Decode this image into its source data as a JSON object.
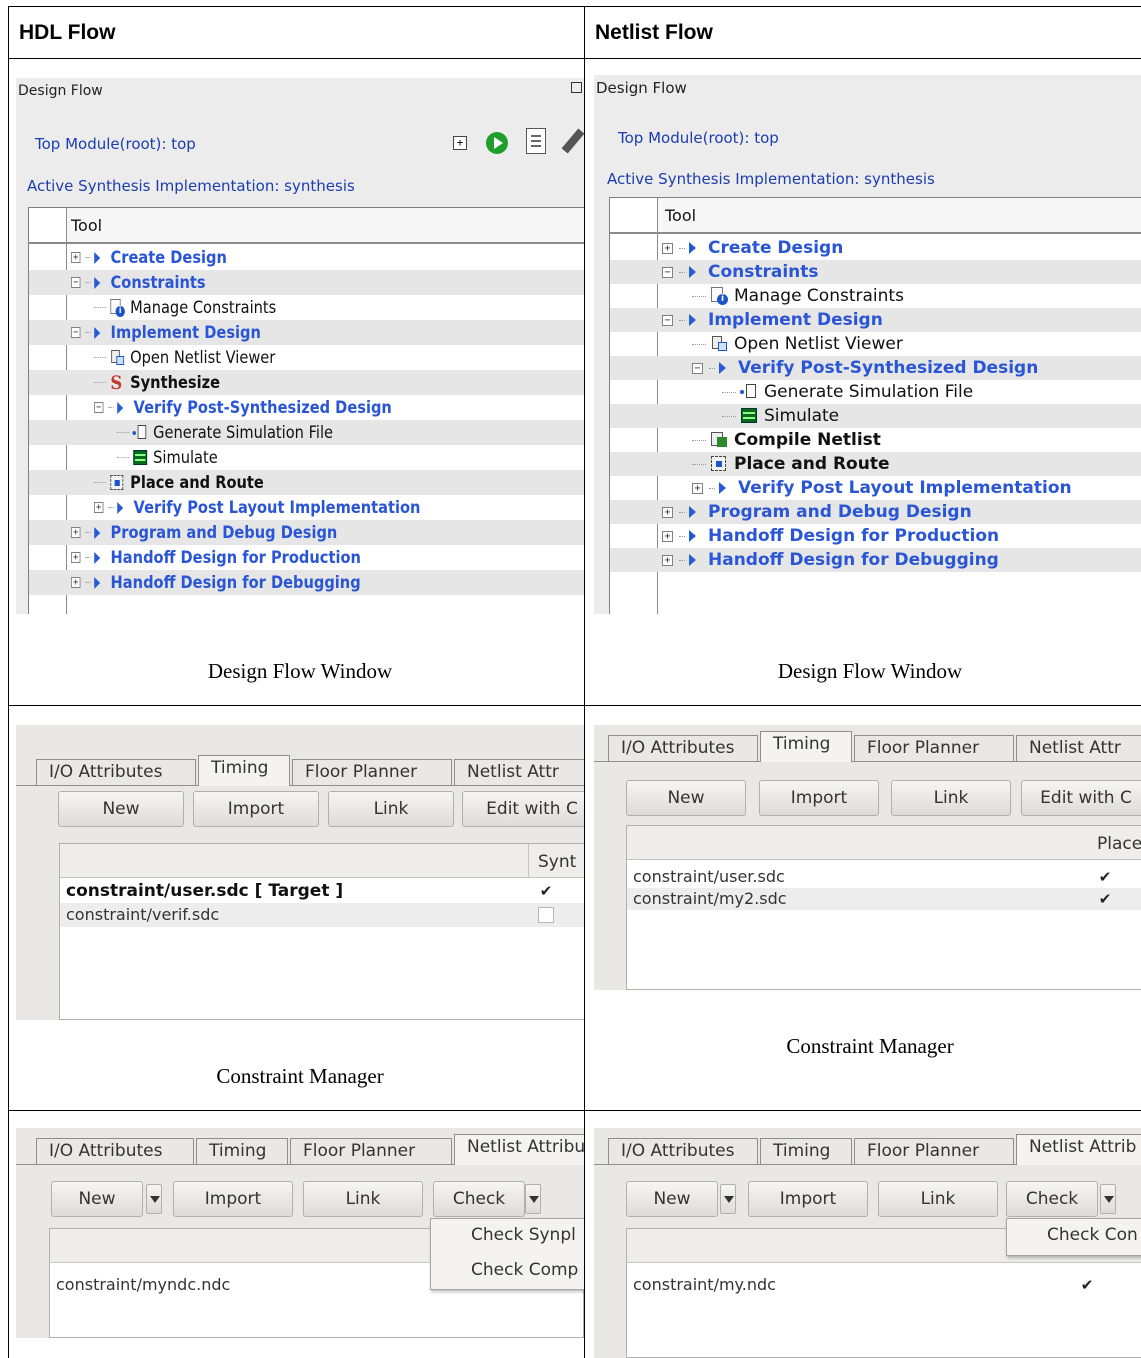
{
  "headers": {
    "hdl": "HDL Flow",
    "netlist": "Netlist Flow"
  },
  "captions": {
    "df_hdl": "Design Flow Window",
    "df_netlist": "Design Flow Window",
    "cm_hdl": "Constraint Manager",
    "cm_netlist": "Constraint Manager"
  },
  "design_flow_hdl": {
    "title": "Design Flow",
    "top_module": "Top Module(root): top",
    "active_impl": "Active Synthesis Implementation: synthesis",
    "column_header": "Tool",
    "toolbar_icons": [
      "expand-all-icon",
      "run-icon",
      "report-icon",
      "wrench-icon"
    ],
    "rows": [
      {
        "label": "Create Design",
        "style": "blue",
        "indent": 0,
        "expander": "+",
        "icon": "triangle"
      },
      {
        "label": "Constraints",
        "style": "blue",
        "indent": 0,
        "expander": "−",
        "icon": "triangle"
      },
      {
        "label": "Manage Constraints",
        "style": "black",
        "indent": 1,
        "icon": "info-doc-icon"
      },
      {
        "label": "Implement Design",
        "style": "blue",
        "indent": 0,
        "expander": "−",
        "icon": "triangle"
      },
      {
        "label": "Open Netlist Viewer",
        "style": "black",
        "indent": 1,
        "icon": "netlist-viewer-icon"
      },
      {
        "label": "Synthesize",
        "style": "bold",
        "indent": 1,
        "icon": "synthesize-icon"
      },
      {
        "label": "Verify Post-Synthesized Design",
        "style": "blue",
        "indent": 1,
        "expander": "−",
        "icon": "triangle"
      },
      {
        "label": "Generate Simulation File",
        "style": "black",
        "indent": 2,
        "icon": "file-icon"
      },
      {
        "label": "Simulate",
        "style": "black",
        "indent": 2,
        "icon": "waveform-icon"
      },
      {
        "label": "Place and Route",
        "style": "bold",
        "indent": 1,
        "icon": "place-route-icon"
      },
      {
        "label": "Verify Post Layout Implementation",
        "style": "blue",
        "indent": 1,
        "expander": "+",
        "icon": "triangle"
      },
      {
        "label": "Program and Debug Design",
        "style": "blue",
        "indent": 0,
        "expander": "+",
        "icon": "triangle"
      },
      {
        "label": "Handoff Design for Production",
        "style": "blue",
        "indent": 0,
        "expander": "+",
        "icon": "triangle"
      },
      {
        "label": "Handoff Design for Debugging",
        "style": "blue",
        "indent": 0,
        "expander": "+",
        "icon": "triangle"
      }
    ]
  },
  "design_flow_netlist": {
    "title": "Design Flow",
    "top_module": "Top Module(root): top",
    "active_impl": "Active Synthesis Implementation: synthesis",
    "column_header": "Tool",
    "rows": [
      {
        "label": "Create Design",
        "style": "blue",
        "indent": 0,
        "expander": "+",
        "icon": "triangle"
      },
      {
        "label": "Constraints",
        "style": "blue",
        "indent": 0,
        "expander": "−",
        "icon": "triangle"
      },
      {
        "label": "Manage Constraints",
        "style": "black",
        "indent": 1,
        "icon": "info-doc-icon"
      },
      {
        "label": "Implement Design",
        "style": "blue",
        "indent": 0,
        "expander": "−",
        "icon": "triangle"
      },
      {
        "label": "Open Netlist Viewer",
        "style": "black",
        "indent": 1,
        "icon": "netlist-viewer-icon"
      },
      {
        "label": "Verify Post-Synthesized Design",
        "style": "blue",
        "indent": 1,
        "expander": "−",
        "icon": "triangle"
      },
      {
        "label": "Generate Simulation File",
        "style": "black",
        "indent": 2,
        "icon": "file-icon"
      },
      {
        "label": "Simulate",
        "style": "black",
        "indent": 2,
        "icon": "waveform-icon"
      },
      {
        "label": "Compile Netlist",
        "style": "bold",
        "indent": 1,
        "icon": "compile-icon"
      },
      {
        "label": "Place and Route",
        "style": "bold",
        "indent": 1,
        "icon": "place-route-icon"
      },
      {
        "label": "Verify Post Layout Implementation",
        "style": "blue",
        "indent": 1,
        "expander": "+",
        "icon": "triangle"
      },
      {
        "label": "Program and Debug Design",
        "style": "blue",
        "indent": 0,
        "expander": "+",
        "icon": "triangle"
      },
      {
        "label": "Handoff Design for Production",
        "style": "blue",
        "indent": 0,
        "expander": "+",
        "icon": "triangle"
      },
      {
        "label": "Handoff Design for Debugging",
        "style": "blue",
        "indent": 0,
        "expander": "+",
        "icon": "triangle"
      }
    ]
  },
  "cm_hdl": {
    "tabs": [
      "I/O Attributes",
      "Timing",
      "Floor Planner",
      "Netlist Attr"
    ],
    "active_tab": "Timing",
    "buttons": [
      "New",
      "Import",
      "Link",
      "Edit with C"
    ],
    "column_header": "Synt",
    "rows": [
      {
        "file": "constraint/user.sdc  [ Target ]",
        "bold": true,
        "checked": true
      },
      {
        "file": "constraint/verif.sdc",
        "bold": false,
        "checked": false
      }
    ]
  },
  "cm_netlist": {
    "tabs": [
      "I/O Attributes",
      "Timing",
      "Floor Planner",
      "Netlist Attr"
    ],
    "active_tab": "Timing",
    "buttons": [
      "New",
      "Import",
      "Link",
      "Edit with C"
    ],
    "column_header": "Place",
    "rows": [
      {
        "file": "constraint/user.sdc",
        "checked": true
      },
      {
        "file": "constraint/my2.sdc",
        "checked": true
      }
    ]
  },
  "ndc_hdl": {
    "tabs": [
      "I/O Attributes",
      "Timing",
      "Floor Planner",
      "Netlist Attribu"
    ],
    "active_tab": "Netlist Attribu",
    "buttons": [
      "New",
      "Import",
      "Link",
      "Check"
    ],
    "menu": [
      "Check Synpl",
      "Check Comp"
    ],
    "rows": [
      {
        "file": "constraint/myndc.ndc"
      }
    ]
  },
  "ndc_netlist": {
    "tabs": [
      "I/O Attributes",
      "Timing",
      "Floor Planner",
      "Netlist Attrib"
    ],
    "active_tab": "Netlist Attrib",
    "buttons": [
      "New",
      "Import",
      "Link",
      "Check"
    ],
    "menu": [
      "Check Con"
    ],
    "rows": [
      {
        "file": "constraint/my.ndc",
        "checked": true
      }
    ]
  },
  "colors": {
    "link_blue": "#2a56d6",
    "header_blue": "#1b3db0",
    "panel_gray": "#ececec"
  }
}
